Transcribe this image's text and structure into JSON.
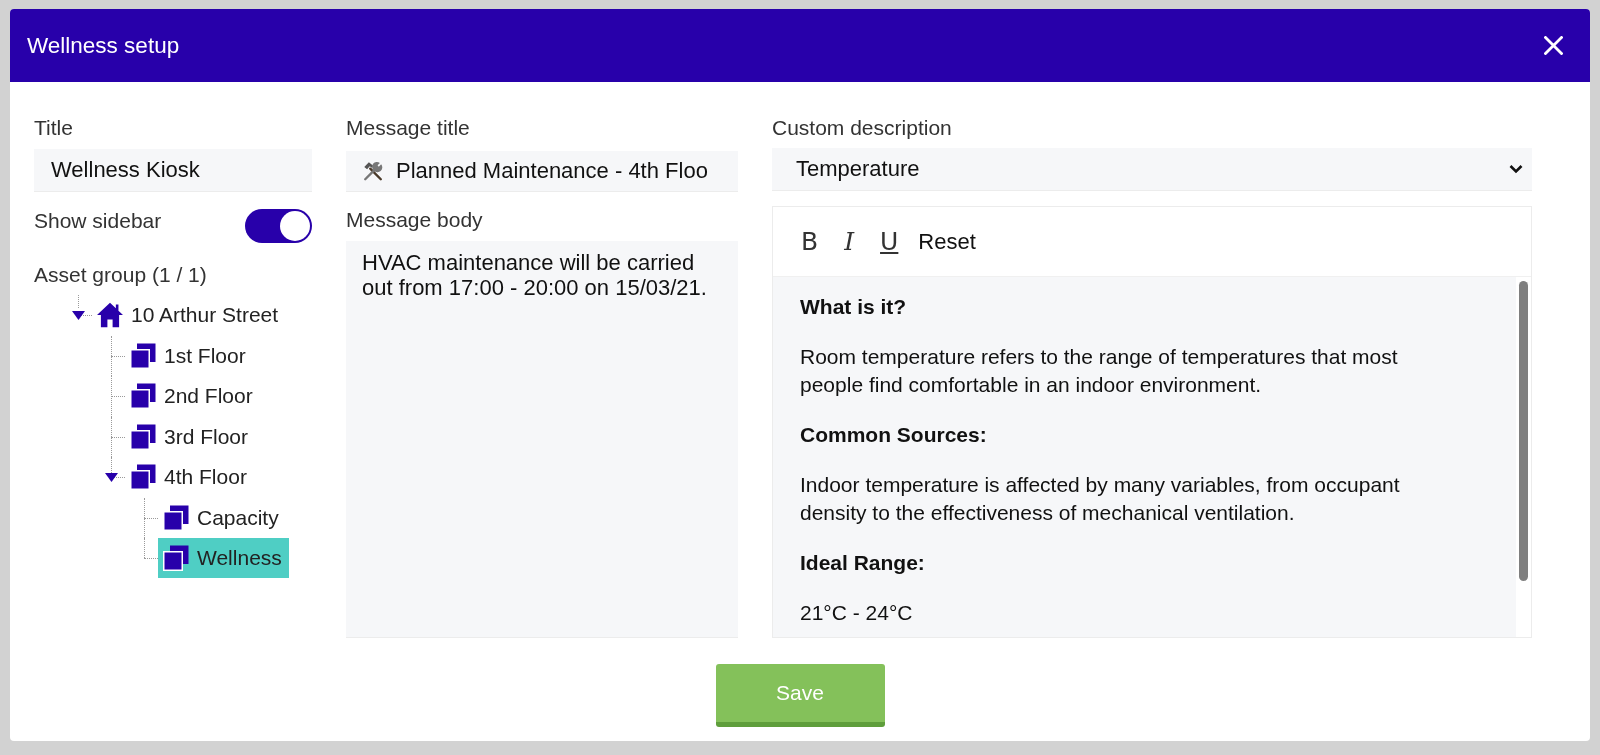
{
  "window": {
    "title": "Wellness setup"
  },
  "title_field": {
    "label": "Title",
    "value": "Wellness Kiosk"
  },
  "show_sidebar": {
    "label": "Show sidebar",
    "on": true
  },
  "asset_group": {
    "label": "Asset group (1 / 1)",
    "tree": [
      {
        "label": "10 Arthur Street",
        "kind": "home",
        "selected": false,
        "expanded": true,
        "children": [
          {
            "label": "1st Floor",
            "kind": "layers",
            "selected": false
          },
          {
            "label": "2nd Floor",
            "kind": "layers",
            "selected": false
          },
          {
            "label": "3rd Floor",
            "kind": "layers",
            "selected": false
          },
          {
            "label": "4th Floor",
            "kind": "layers",
            "selected": false,
            "expanded": true,
            "children": [
              {
                "label": "Capacity",
                "kind": "layers",
                "selected": false
              },
              {
                "label": "Wellness",
                "kind": "layers",
                "selected": true
              }
            ]
          }
        ]
      }
    ]
  },
  "message_title": {
    "label": "Message title",
    "value": "Planned Maintenance - 4th Floo"
  },
  "message_body": {
    "label": "Message body",
    "value": "HVAC maintenance will be carried out from 17:00 - 20:00 on 15/03/21."
  },
  "custom_description": {
    "label": "Custom description",
    "value": "Temperature",
    "toolbar": [
      {
        "kind": "bold",
        "label": "B"
      },
      {
        "kind": "italic",
        "label": "I"
      },
      {
        "kind": "underline",
        "label": "U"
      },
      {
        "kind": "reset",
        "label": "Reset"
      }
    ],
    "content": [
      {
        "kind": "heading",
        "text": "What is it?"
      },
      {
        "kind": "paragraph",
        "text": "Room temperature refers to the range of temperatures that most people find comfortable in an indoor environment."
      },
      {
        "kind": "heading",
        "text": "Common Sources:"
      },
      {
        "kind": "paragraph",
        "text": "Indoor temperature is affected by many variables, from occupant density to the effectiveness of mechanical ventilation."
      },
      {
        "kind": "heading",
        "text": "Ideal Range:"
      },
      {
        "kind": "paragraph",
        "text": "21°C - 24°C"
      }
    ]
  },
  "buttons": [
    {
      "label": "Save"
    }
  ]
}
